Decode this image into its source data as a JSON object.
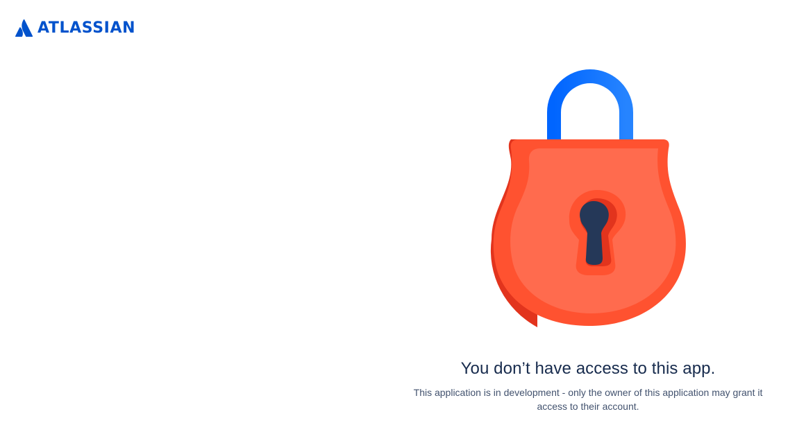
{
  "header": {
    "brand_name": "ATLASSIAN",
    "logo_icon": "atlassian-logo-icon",
    "brand_color": "#0052CC"
  },
  "illustration": {
    "icon": "padlock-icon",
    "shackle_color": "#2684FF",
    "body_color": "#FF5630",
    "keyhole_color": "#253858"
  },
  "message": {
    "title": "You don’t have access to this app.",
    "body": "This application is in development - only the owner of this application may grant it access to their account."
  }
}
